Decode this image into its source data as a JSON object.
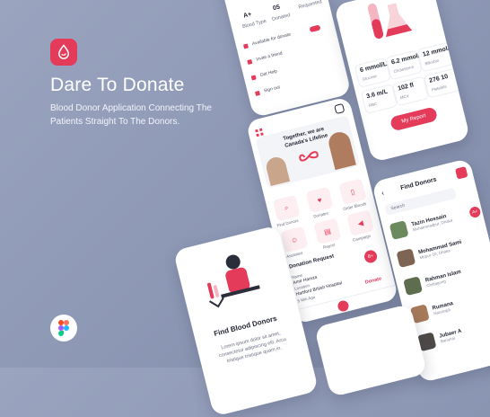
{
  "brand": {
    "title": "Dare To Donate",
    "subtitle": "Blood Donor Application Connecting The Patients Straight To The Donors.",
    "accent": "#e53b5a"
  },
  "profile_screen": {
    "blood_type": "A+",
    "blood_type_label": "Blood Type",
    "donated_count": "05",
    "donated_label": "Donated",
    "requested_label": "Requested",
    "menu": [
      "Available for donate",
      "Invite a friend",
      "Get Help",
      "Sign out"
    ]
  },
  "report_screen": {
    "stats": [
      {
        "value": "6 mmol/L",
        "label": "Glucose"
      },
      {
        "value": "6.2 mmol/L",
        "label": "Cholesterol"
      },
      {
        "value": "12 mmol/L",
        "label": "Bilirubin"
      },
      {
        "value": "3.6 m/L",
        "label": "RBC"
      },
      {
        "value": "102 fl",
        "label": "MCV"
      },
      {
        "value": "276 10",
        "label": "Platelets"
      }
    ],
    "button": "My Report"
  },
  "home_screen": {
    "banner_line1": "Together, we are",
    "banner_line2": "Canada's Lifeline",
    "actions": [
      "Find Donors",
      "Donates",
      "Order Bloods",
      "Assistant",
      "Report",
      "Campaign"
    ],
    "request_title": "Donation Request",
    "request_name_label": "Name",
    "request_name": "Amir Hamza",
    "request_location_label": "Location",
    "request_location": "Hartford British Hospital",
    "request_time": "5 Min Ago",
    "request_group": "B+",
    "request_button": "Donate"
  },
  "find_screen": {
    "title": "Find Donors",
    "search_placeholder": "Search",
    "donors": [
      {
        "name": "Tazin Hossain",
        "location": "Mohammadpur, Dhaka",
        "group": "A+"
      },
      {
        "name": "Mohammad Sami",
        "location": "Mirpur-10, Dhaka"
      },
      {
        "name": "Rahman Islam",
        "location": "Chittagong"
      },
      {
        "name": "Rumana",
        "location": "Narsingdi"
      },
      {
        "name": "Jubaer A",
        "location": "Barishal"
      }
    ]
  },
  "onboarding_screen": {
    "title": "Find Blood Donors",
    "body": "Lorem ipsum dolor sit amet, consectetur adipiscing elit. Arcu tristique tristique quam in."
  }
}
